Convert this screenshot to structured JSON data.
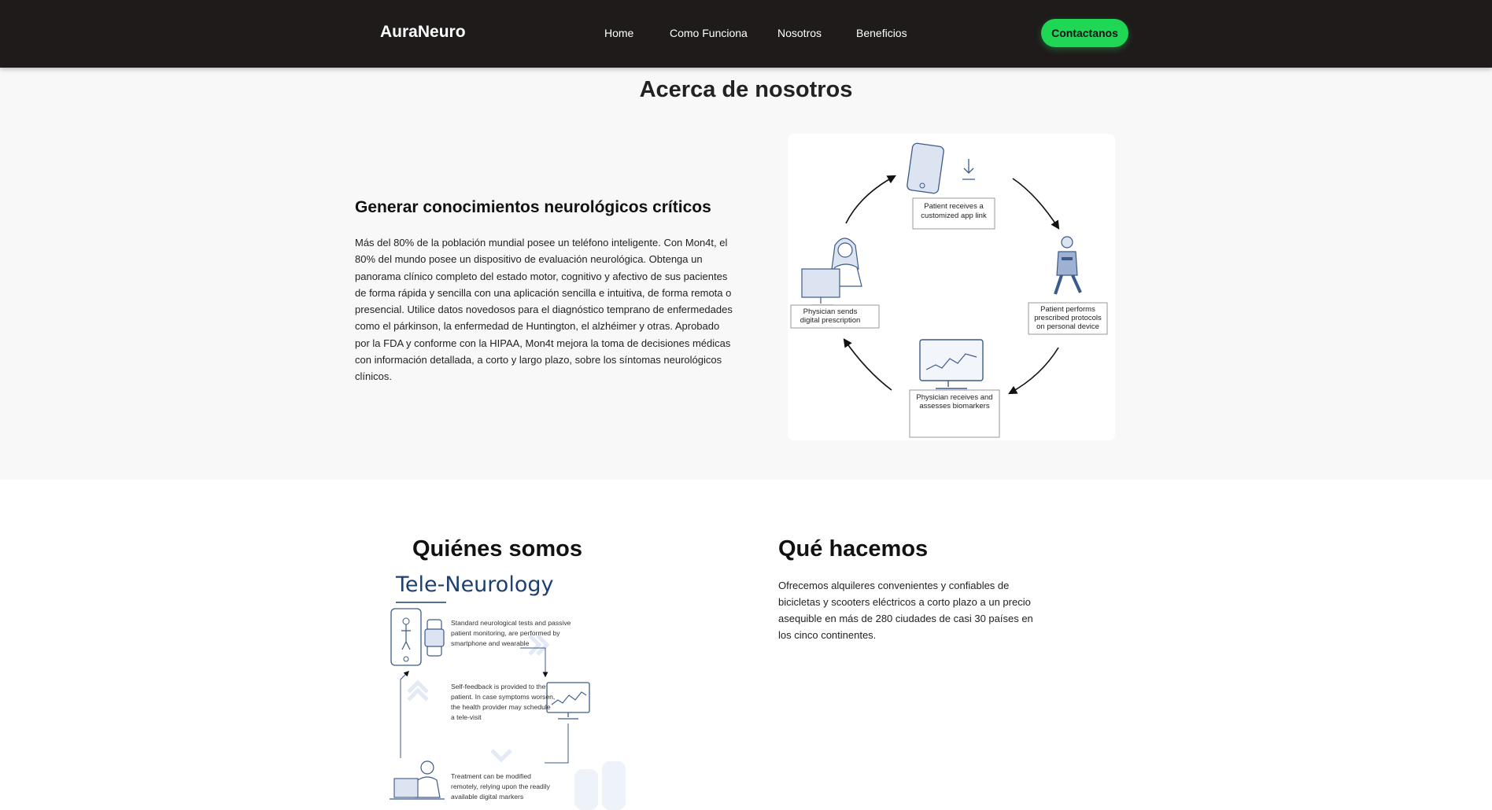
{
  "nav": {
    "brand": "AuraNeuro",
    "links": [
      "Home",
      "Como Funciona",
      "Nosotros",
      "Beneficios"
    ],
    "cta": "Contactanos"
  },
  "about": {
    "title": "Acerca de nosotros",
    "subtitle": "Generar conocimientos neurológicos críticos",
    "body": "Más del 80% de la población mundial posee un teléfono inteligente. Con Mon4t, el 80% del mundo posee un dispositivo de evaluación neurológica. Obtenga un panorama clínico completo del estado motor, cognitivo y afectivo de sus pacientes de forma rápida y sencilla con una aplicación sencilla e intuitiva, de forma remota o presencial. Utilice datos novedosos para el diagnóstico temprano de enfermedades como el párkinson, la enfermedad de Huntington, el alzhéimer y otras. Aprobado por la FDA y conforme con la HIPAA, Mon4t mejora la toma de decisiones médicas con información detallada, a corto y largo plazo, sobre los síntomas neurológicos clínicos.",
    "diagram": {
      "step1": [
        "Patient receives a",
        "customized app link"
      ],
      "step2": [
        "Patient performs",
        "prescribed protocols",
        "on personal device"
      ],
      "step3": [
        "Physician receives and",
        "assesses biomarkers"
      ],
      "step4": [
        "Physician sends",
        "digital prescription"
      ]
    }
  },
  "team": {
    "who_title": "Quiénes somos",
    "tele": {
      "heading": "Tele-Neurology",
      "note1": [
        "Standard neurological tests and passive",
        "patient monitoring, are  performed by",
        "smartphone and wearable"
      ],
      "note2": [
        "Self-feedback is provided to the",
        "patient. In case symptoms worsen,",
        "the health provider may schedule",
        "a tele-visit"
      ],
      "note3": [
        "Treatment can be modified",
        "remotely, relying upon the readily",
        "available digital markers"
      ]
    },
    "what_title": "Qué hacemos",
    "what_body": "Ofrecemos alquileres convenientes y confiables de bicicletas y scooters eléctricos a corto plazo a un precio asequible en más de 280 ciudades de casi 30 países en los cinco continentes."
  },
  "colors": {
    "navbar": "#1f1b1b",
    "cta": "#1fd655",
    "section_bg": "#f8f8f8",
    "illustration": "#3c5a8a"
  }
}
